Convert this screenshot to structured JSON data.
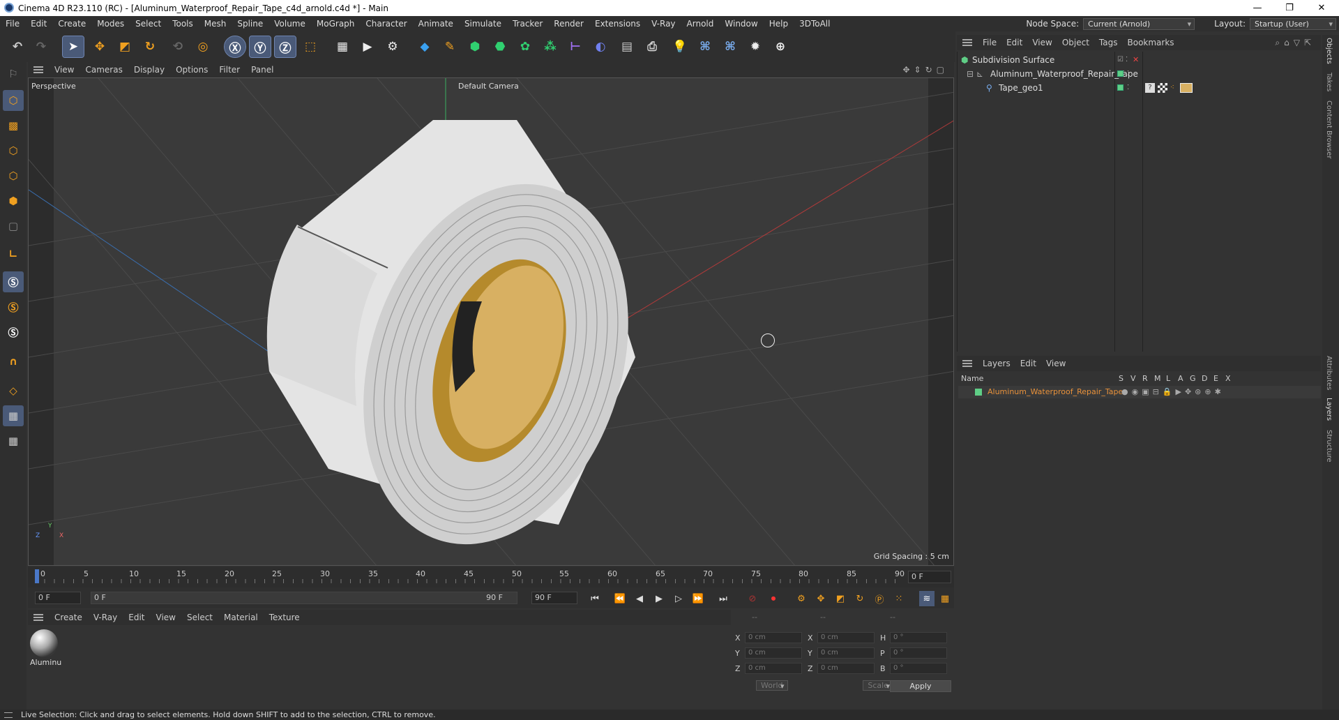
{
  "window": {
    "title": "Cinema 4D R23.110 (RC) - [Aluminum_Waterproof_Repair_Tape_c4d_arnold.c4d *] - Main",
    "min": "—",
    "max": "❐",
    "close": "✕"
  },
  "menu": [
    "File",
    "Edit",
    "Create",
    "Modes",
    "Select",
    "Tools",
    "Mesh",
    "Spline",
    "Volume",
    "MoGraph",
    "Character",
    "Animate",
    "Simulate",
    "Tracker",
    "Render",
    "Extensions",
    "V-Ray",
    "Arnold",
    "Window",
    "Help",
    "3DToAll"
  ],
  "nodespace": {
    "label": "Node Space:",
    "value": "Current (Arnold)",
    "layout_label": "Layout:",
    "layout_value": "Startup (User)"
  },
  "viewport": {
    "menu": [
      "View",
      "Cameras",
      "Display",
      "Options",
      "Filter",
      "Panel"
    ],
    "name": "Perspective",
    "camera": "Default Camera",
    "grid": "Grid Spacing : 5 cm",
    "axes": {
      "y": "Y",
      "z": "Z",
      "x": "X"
    }
  },
  "timeline": {
    "ticks": [
      "0",
      "5",
      "10",
      "15",
      "20",
      "25",
      "30",
      "35",
      "40",
      "45",
      "50",
      "55",
      "60",
      "65",
      "70",
      "75",
      "80",
      "85",
      "90"
    ],
    "current": "0 F"
  },
  "playbar": {
    "start": "0 F",
    "range_start": "0 F",
    "range_end": "90 F",
    "end": "90 F"
  },
  "material": {
    "menu": [
      "Create",
      "V-Ray",
      "Edit",
      "View",
      "Select",
      "Material",
      "Texture"
    ],
    "items": [
      {
        "name": "Aluminu"
      }
    ]
  },
  "coords": {
    "headers": [
      "--",
      "--",
      "--"
    ],
    "rows": [
      {
        "a": "X",
        "av": "0 cm",
        "b": "X",
        "bv": "0 cm",
        "c": "H",
        "cv": "0 °"
      },
      {
        "a": "Y",
        "av": "0 cm",
        "b": "Y",
        "bv": "0 cm",
        "c": "P",
        "cv": "0 °"
      },
      {
        "a": "Z",
        "av": "0 cm",
        "b": "Z",
        "bv": "0 cm",
        "c": "B",
        "cv": "0 °"
      }
    ],
    "world": "World",
    "scale": "Scale",
    "apply": "Apply"
  },
  "objects": {
    "menu": [
      "File",
      "Edit",
      "View",
      "Object",
      "Tags",
      "Bookmarks"
    ],
    "items": [
      {
        "name": "Subdivision Surface"
      },
      {
        "name": "Aluminum_Waterproof_Repair_Tape"
      },
      {
        "name": "Tape_geo1"
      }
    ]
  },
  "layers": {
    "menu": [
      "Layers",
      "Edit",
      "View"
    ],
    "cols": [
      "S",
      "V",
      "R",
      "M",
      "L",
      "A",
      "G",
      "D",
      "E",
      "X"
    ],
    "name_header": "Name",
    "items": [
      {
        "name": "Aluminum_Waterproof_Repair_Tape"
      }
    ]
  },
  "right_tabs": [
    "Objects",
    "Takes",
    "Content Browser",
    "Attributes",
    "Layers",
    "Structure"
  ],
  "status": "Live Selection: Click and drag to select elements. Hold down SHIFT to add to the selection, CTRL to remove.",
  "colors": {
    "accent": "#4a5a78",
    "layer_name": "#e8913a",
    "green": "#5fce86"
  }
}
